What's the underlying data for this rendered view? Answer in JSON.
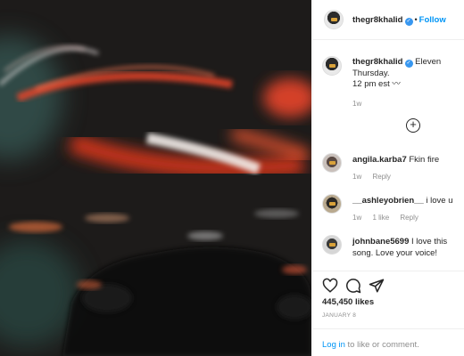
{
  "post": {
    "author": "thegr8khalid",
    "follow_label": "Follow",
    "dot": "•",
    "verified_glyph": "✓",
    "caption_lines": [
      "Eleven",
      "Thursday.",
      "12 pm est"
    ],
    "caption_emoji": "〰",
    "caption_age": "1w",
    "likes": "445,450 likes",
    "date": "JANUARY 8"
  },
  "comments": [
    {
      "user": "angila.karba7",
      "text": "Fkin fire",
      "age": "1w",
      "likes": "",
      "reply": "Reply"
    },
    {
      "user": "__ashleyobrien__",
      "text": "i love u",
      "age": "1w",
      "likes": "1 like",
      "reply": "Reply"
    },
    {
      "user": "johnbane5699",
      "text": "I love this song. Love your voice!",
      "age": "",
      "likes": "",
      "reply": ""
    }
  ],
  "add_comment_glyph": "+",
  "footer": {
    "login_label": "Log in",
    "login_suffix": " to like or comment."
  },
  "icons": [
    "heart-icon",
    "comment-icon",
    "share-icon",
    "add-comment-icon",
    "verified-badge-icon"
  ],
  "colors": {
    "accent": "#0095f6",
    "muted": "#8e8e8e",
    "text": "#262626",
    "divider": "#efefef"
  }
}
